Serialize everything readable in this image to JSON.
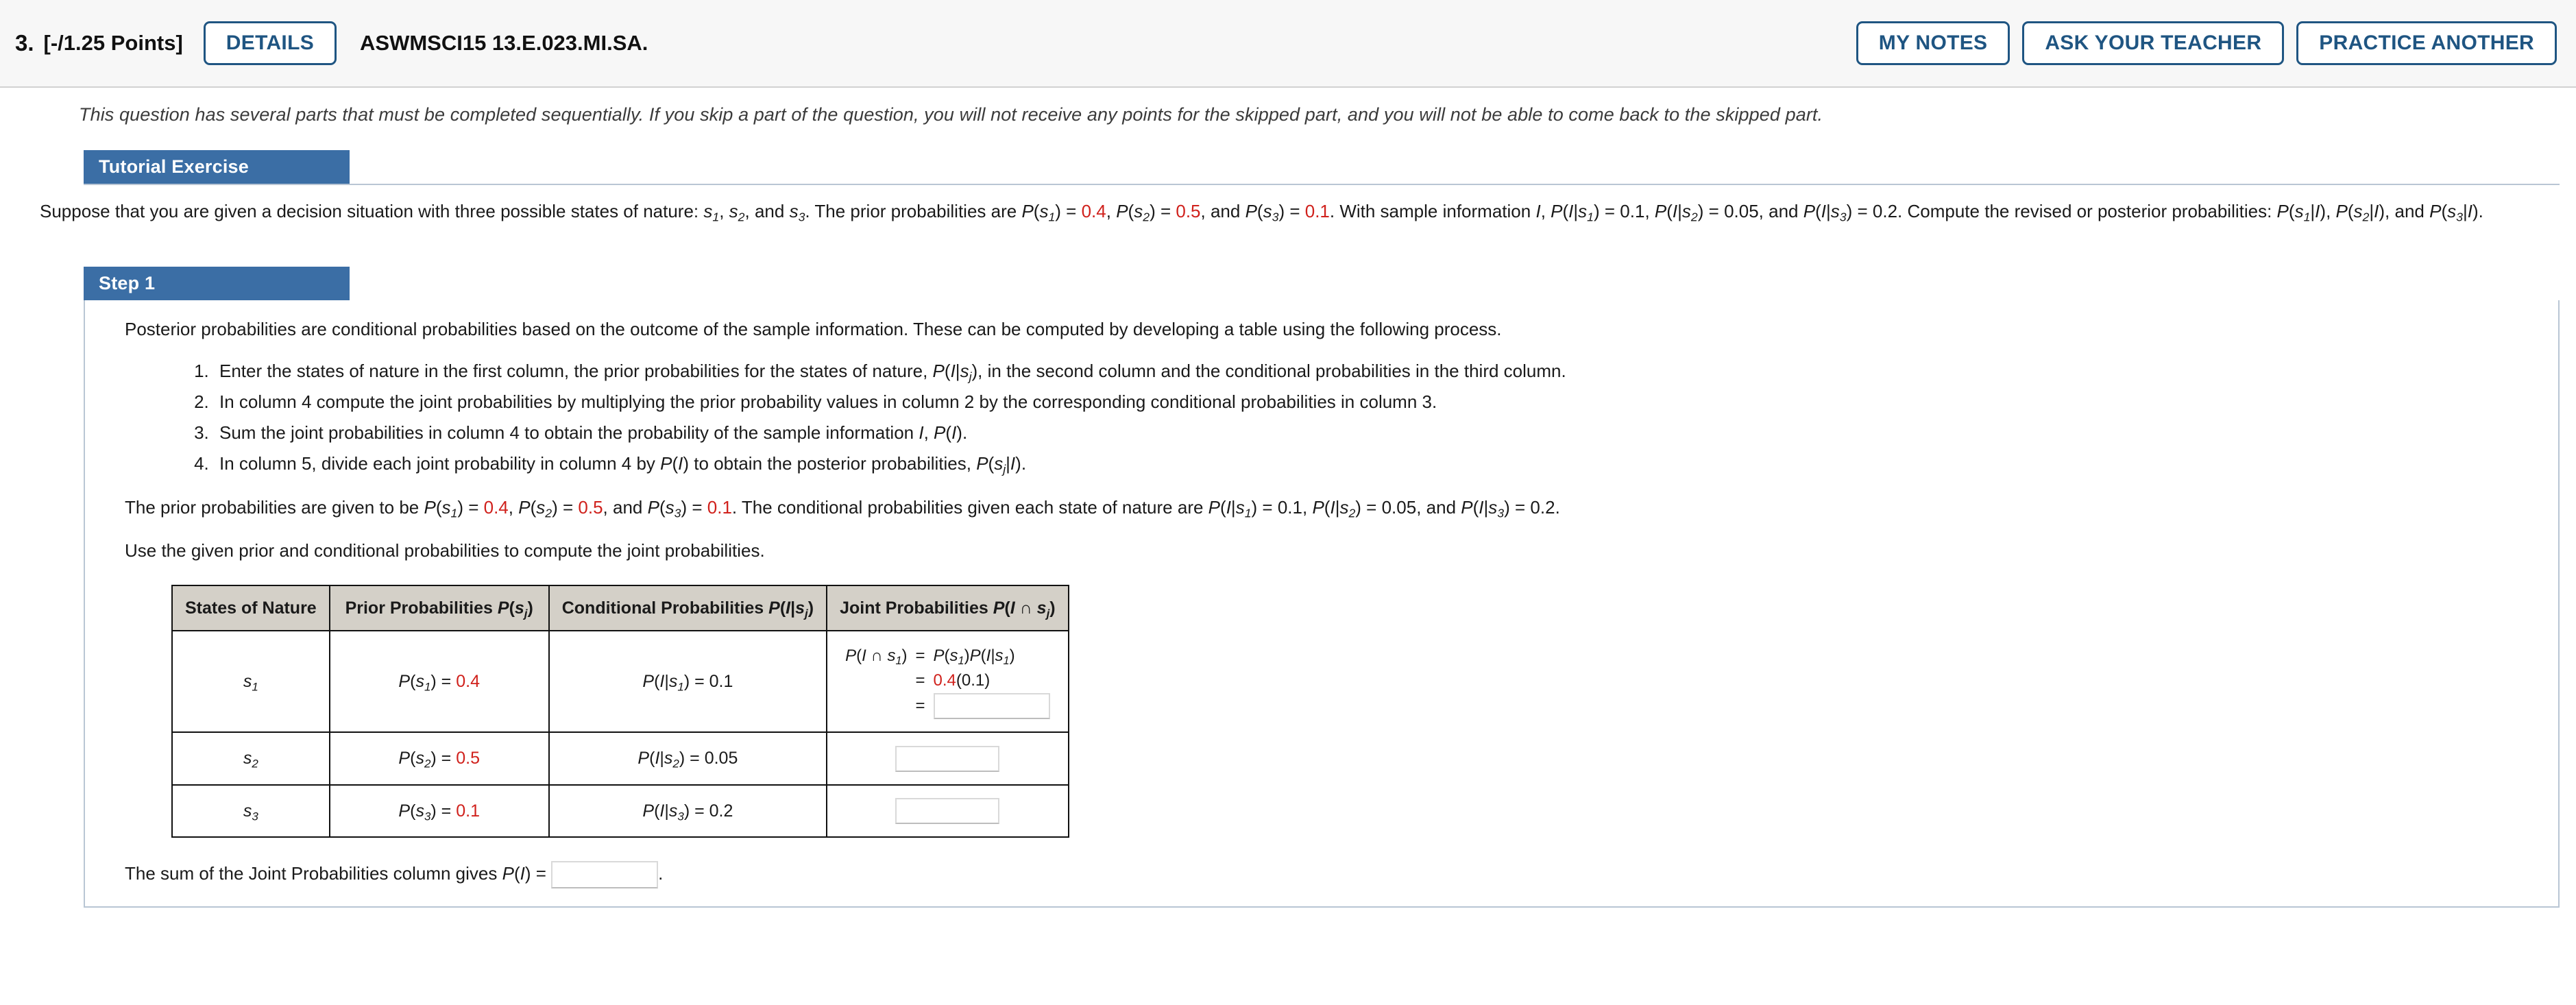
{
  "header": {
    "question_number": "3.",
    "points": "[-/1.25 Points]",
    "details_button": "DETAILS",
    "question_code": "ASWMSCI15 13.E.023.MI.SA.",
    "my_notes_button": "MY NOTES",
    "ask_teacher_button": "ASK YOUR TEACHER",
    "practice_another_button": "PRACTICE ANOTHER",
    "accent_color": "#1f5582"
  },
  "notice": "This question has several parts that must be completed sequentially. If you skip a part of the question, you will not receive any points for the skipped part, and you will not be able to come back to the skipped part.",
  "tutorial": {
    "tab_label": "Tutorial Exercise",
    "prior_values": [
      "0.4",
      "0.5",
      "0.1"
    ],
    "conditional_values": [
      "0.1",
      "0.05",
      "0.2"
    ]
  },
  "step1": {
    "tab_label": "Step 1",
    "intro": "Posterior probabilities are conditional probabilities based on the outcome of the sample information. These can be computed by developing a table using the following process.",
    "list_tail_1": ", in the second column and the conditional probabilities in the third column.",
    "list_2": "In column 4 compute the joint probabilities by multiplying the prior probability values in column 2 by the corresponding conditional probabilities in column 3.",
    "list_3_head": "Sum the joint probabilities in column 4 to obtain the probability of the sample information ",
    "list_4_head": "In column 5, divide each joint probability in column 4 by ",
    "list_4_mid": " to obtain the posterior probabilities, ",
    "use_given": "Use the given prior and conditional probabilities to compute the joint probabilities.",
    "sum_line_prefix": "The sum of the Joint Probabilities column gives ",
    "sum_line_suffix": "."
  },
  "table": {
    "headers": {
      "states": "States of Nature",
      "prior": "Prior Probabilities",
      "conditional": "Conditional Probabilities",
      "joint": "Joint Probabilities"
    },
    "rows": [
      {
        "state": "1",
        "prior_value": "0.4",
        "conditional_value": "0.1",
        "joint_expression": "0.4(0.1)",
        "joint_answer": ""
      },
      {
        "state": "2",
        "prior_value": "0.5",
        "conditional_value": "0.05",
        "joint_answer": ""
      },
      {
        "state": "3",
        "prior_value": "0.1",
        "conditional_value": "0.2",
        "joint_answer": ""
      }
    ],
    "sum_answer": ""
  },
  "colors": {
    "red_highlight": "#d0211c",
    "section_tab": "#3b6ea5",
    "table_header_bg": "#d4d0c8"
  }
}
